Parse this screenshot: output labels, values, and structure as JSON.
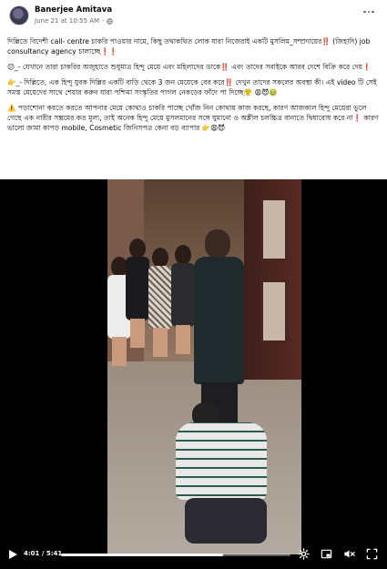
{
  "post": {
    "author": "Banerjee Amitava",
    "date": "June 21 at 10:55 AM",
    "separator": "·",
    "privacy_icon": "globe-icon",
    "more_icon": "more-options-icon"
  },
  "content": {
    "p1": "দিল্লিতে বিদেশী call- centre চাকরি পাওয়ার নামে, কিছু তথাকথিত লোক যারা নিজেরাই একটি মুসলিম_সম্প্রদায়ের‼️ (জিহাদি) job consultancy agency  চালাচ্ছে❗❗",
    "p2": "😕_- যেখানে তারা চাকরির অজুহাতে শুধুমাত্র হিন্দু মেয়ে এবং মহিলাদের ডাকে‼️ এবং তাদের সবাইকে আরব দেশে বিক্রি করে দেয়❗",
    "p3": "👉_- দিল্লিতে, এক হিন্দু যুবক দিল্লির একটি বাড়ি থেকে 3 জন মেয়েকে বের করে‼️ দেখুন তাদের সকলের অবস্থা কী। এই video টি সেই সমস্ত মেয়েদের সাথে শেয়ার করুন যারা পশ্চিমা সংস্কৃতির পাগল নেকড়ের ফাঁদে পা দিচ্ছে😤 😩😈🤢",
    "p4": "⚠️ পড়াশোনা করতে করতে আপনার মেয়ে কোথাও চাকরি পাচ্ছে খোঁজ নিন কোথায় কাজ করছে, কারণ আজকাল হিন্দু মেয়েরা ভুলে গেছে এক নারীর সম্ভ্রমের কত মূল্য, তাই অনেক হিন্দু মেয়ে মুসলমানের সঙ্গে ঘুমানো ও অশ্লীল চলচ্চিত্র বানাতে দ্বিধাবোধ করে না❗ কারণ ভালো জামা কাপড় mobile, Cosmetic জিনিসপত্র কেনা বড় ব্যাপার 👉😩😈"
  },
  "video": {
    "current_time": "4:01",
    "time_separator": " / ",
    "duration": "5:41",
    "progress": 0.706,
    "icons": [
      "play-icon",
      "settings-icon",
      "volume-muted-icon",
      "fullscreen-icon"
    ]
  },
  "colors": {
    "accent": "#1877f2",
    "text_primary": "#050505",
    "text_secondary": "#65676b"
  }
}
